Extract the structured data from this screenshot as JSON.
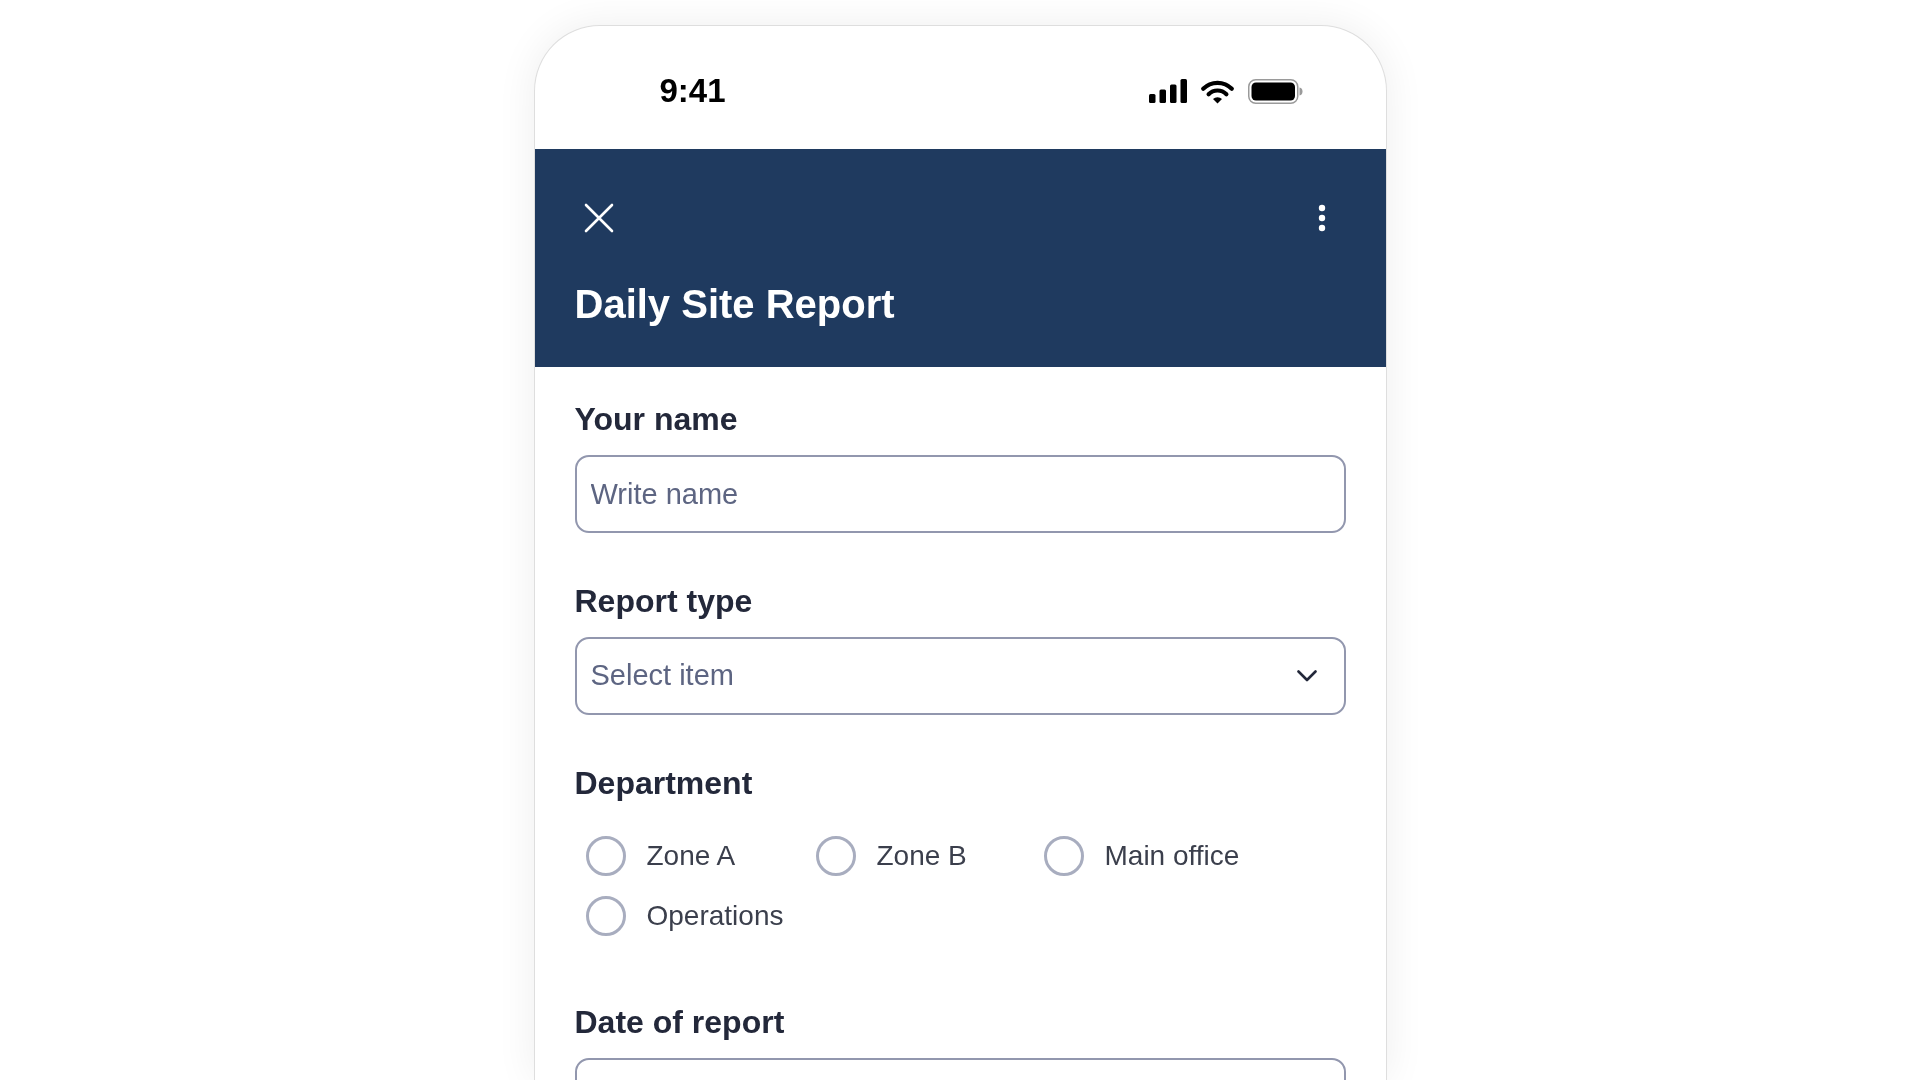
{
  "status_bar": {
    "time": "9:41"
  },
  "header": {
    "title": "Daily Site Report"
  },
  "form": {
    "fields": [
      {
        "kind": "text",
        "label": "Your name",
        "placeholder": "Write name"
      },
      {
        "kind": "select",
        "label": "Report type",
        "placeholder": "Select item"
      },
      {
        "kind": "radio",
        "label": "Department",
        "options": [
          {
            "label": "Zone A",
            "selected": false
          },
          {
            "label": "Zone B",
            "selected": false
          },
          {
            "label": "Main office",
            "selected": false
          },
          {
            "label": "Operations",
            "selected": false
          }
        ]
      },
      {
        "kind": "date",
        "label": "Date of report"
      }
    ]
  }
}
